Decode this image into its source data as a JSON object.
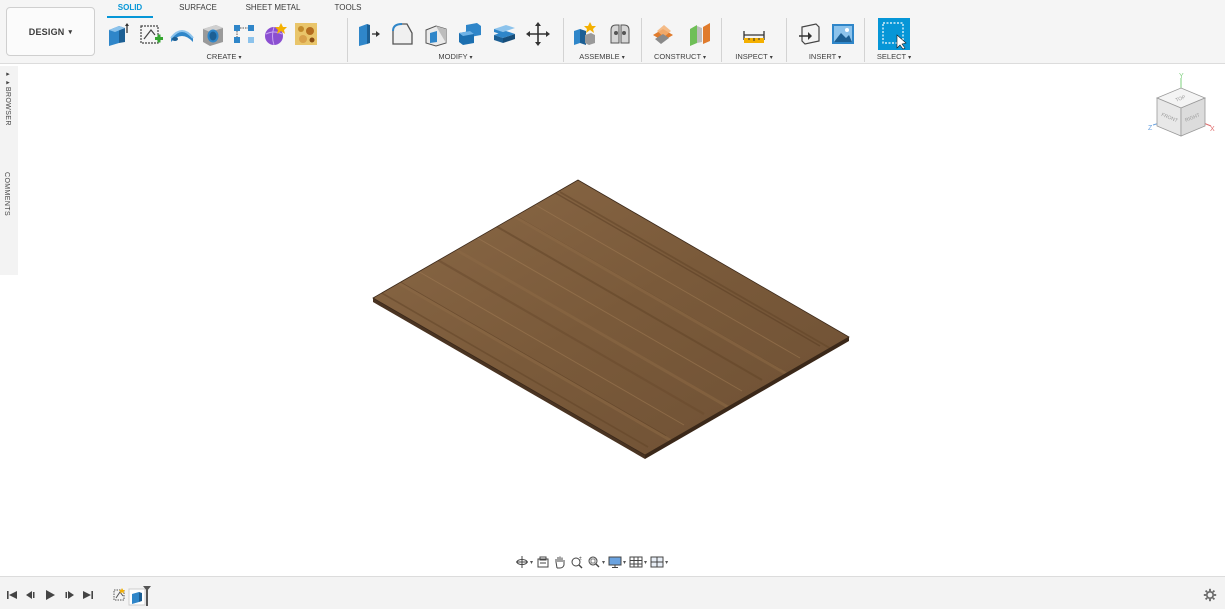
{
  "toolbar": {
    "workspace_label": "DESIGN",
    "workspace_caret": "▾",
    "tabs": [
      {
        "label": "SOLID",
        "active": true
      },
      {
        "label": "SURFACE",
        "active": false
      },
      {
        "label": "SHEET METAL",
        "active": false
      },
      {
        "label": "TOOLS",
        "active": false
      }
    ],
    "groups": {
      "create": {
        "label": "CREATE",
        "icons": [
          "extrude-icon",
          "create-sketch-icon",
          "sweep-icon",
          "hole-icon",
          "pattern-icon",
          "create-form-icon",
          "decal-icon"
        ]
      },
      "modify": {
        "label": "MODIFY",
        "icons": [
          "press-pull-icon",
          "fillet-icon",
          "shell-icon",
          "combine-icon",
          "replace-face-icon",
          "move-icon"
        ]
      },
      "assemble": {
        "label": "ASSEMBLE",
        "icons": [
          "new-component-icon",
          "joint-icon"
        ]
      },
      "construct": {
        "label": "CONSTRUCT",
        "icons": [
          "offset-plane-icon",
          "midplane-icon"
        ]
      },
      "inspect": {
        "label": "INSPECT",
        "icons": [
          "measure-icon"
        ]
      },
      "insert": {
        "label": "INSERT",
        "icons": [
          "insert-derive-icon",
          "insert-image-icon"
        ]
      },
      "select": {
        "label": "SELECT",
        "icons": [
          "select-icon"
        ]
      }
    },
    "colors": {
      "accent": "#0696d7",
      "toolbar_bg": "#f5f5f5"
    }
  },
  "left_panel": {
    "browser_label": "BROWSER",
    "comments_label": "COMMENTS",
    "browser_arrow": "▸▸"
  },
  "viewcube": {
    "faces": {
      "top": "TOP",
      "front": "FRONT",
      "right": "RIGHT"
    },
    "axes": {
      "x": "X",
      "y": "Y",
      "z": "Z"
    }
  },
  "model": {
    "description_color_top": "#7b5a3a",
    "edge_color": "#4a3422"
  },
  "nav_bar": {
    "icons": [
      "orbit-icon",
      "look-at-icon",
      "pan-icon",
      "zoom-icon",
      "fit-icon",
      "display-settings-icon",
      "grid-settings-icon",
      "viewports-icon"
    ]
  },
  "timeline": {
    "controls": [
      "go-to-start-icon",
      "previous-step-icon",
      "play-icon",
      "next-step-icon",
      "go-to-end-icon"
    ]
  }
}
